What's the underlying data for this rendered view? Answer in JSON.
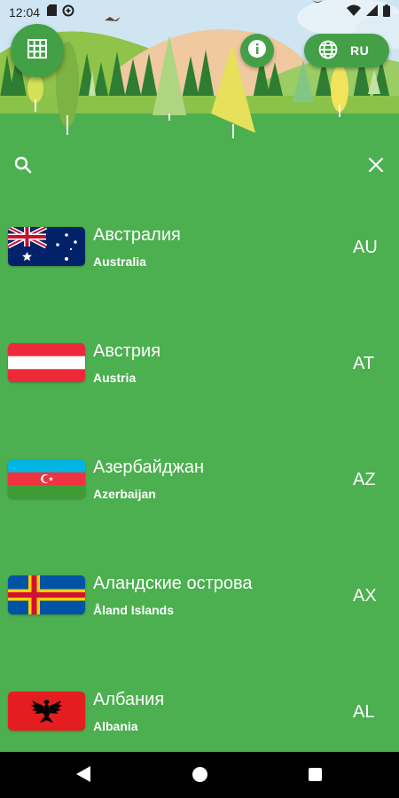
{
  "status_bar": {
    "time": "12:04",
    "icons": [
      "sd-card-icon",
      "data-saver-icon",
      "wifi-icon",
      "signal-icon",
      "battery-icon"
    ]
  },
  "header": {
    "menu_icon": "grid-icon",
    "info_icon": "info-icon",
    "language": {
      "icon": "globe-icon",
      "label": "RU"
    }
  },
  "search": {
    "value": "",
    "placeholder": "",
    "search_icon": "search-icon",
    "clear_icon": "close-icon"
  },
  "countries": [
    {
      "name_ru": "Австралия",
      "name_en": "Australia",
      "code": "AU"
    },
    {
      "name_ru": "Австрия",
      "name_en": "Austria",
      "code": "AT"
    },
    {
      "name_ru": "Азербайджан",
      "name_en": "Azerbaijan",
      "code": "AZ"
    },
    {
      "name_ru": "Аландские острова",
      "name_en": "Åland Islands",
      "code": "AX"
    },
    {
      "name_ru": "Албания",
      "name_en": "Albania",
      "code": "AL"
    }
  ],
  "nav_bar": {
    "icons": [
      "back-icon",
      "home-icon",
      "recents-icon"
    ]
  },
  "colors": {
    "background": "#4caf50",
    "button": "#43a047",
    "sky": "#cfe6f2",
    "nav_bar": "#000000"
  }
}
